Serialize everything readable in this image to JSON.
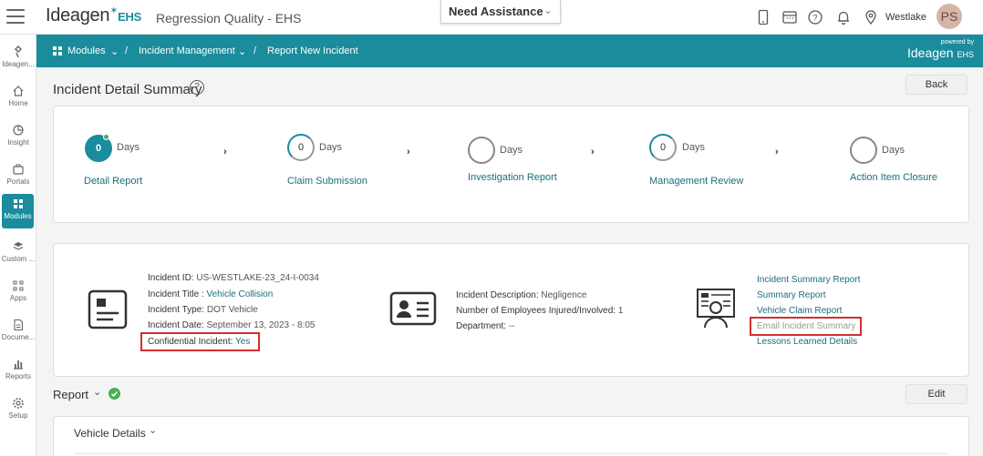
{
  "header": {
    "logo_text": "Ideagen",
    "logo_ehs": "EHS",
    "app_title": "Regression Quality - EHS",
    "assistance_label": "Need Assistance",
    "org_name": "Westlake",
    "avatar_initials": "PS"
  },
  "sidebar": {
    "items": [
      {
        "label": "Ideagen...",
        "icon": "ideagen-logo-icon"
      },
      {
        "label": "Home",
        "icon": "home-icon"
      },
      {
        "label": "Insight",
        "icon": "insight-icon"
      },
      {
        "label": "Portals",
        "icon": "portals-icon"
      },
      {
        "label": "Modules",
        "icon": "modules-icon",
        "active": true
      },
      {
        "label": "Custom ...",
        "icon": "custom-icon"
      },
      {
        "label": "Apps",
        "icon": "apps-icon"
      },
      {
        "label": "Docume...",
        "icon": "documents-icon"
      },
      {
        "label": "Reports",
        "icon": "reports-icon"
      },
      {
        "label": "Setup",
        "icon": "setup-icon"
      }
    ]
  },
  "breadcrumb": {
    "modules": "Modules",
    "sep1": "/",
    "incident_management": "Incident Management",
    "sep2": "/",
    "current": "Report New Incident",
    "powered_by": "powered by",
    "powered_logo": "Ideagen",
    "powered_ehs": "EHS"
  },
  "page": {
    "title": "Incident Detail Summary",
    "help_glyph": "?",
    "back_label": "Back"
  },
  "steps": [
    {
      "label": "Detail Report",
      "count": "0",
      "days": "Days",
      "state": "filled"
    },
    {
      "label": "Claim Submission",
      "count": "0",
      "days": "Days",
      "state": "partial"
    },
    {
      "label": "Investigation Report",
      "count": "",
      "days": "Days",
      "state": "empty"
    },
    {
      "label": "Management Review",
      "count": "0",
      "days": "Days",
      "state": "partial"
    },
    {
      "label": "Action Item Closure",
      "count": "",
      "days": "Days",
      "state": "empty"
    }
  ],
  "step_arrow": "›",
  "incident": {
    "id_label": "Incident ID:",
    "id_value": "US-WESTLAKE-23_24-I-0034",
    "title_label": "Incident Title :",
    "title_value": "Vehicle Collision",
    "type_label": "Incident Type:",
    "type_value": "DOT Vehicle",
    "date_label": "Incident Date:",
    "date_value": "September 13, 2023 - 8:05",
    "confidential_label": "Confidential Incident:",
    "confidential_value": "Yes",
    "description_label": "Incident Description:",
    "description_value": "Negligence",
    "injured_label": "Number of Employees Injured/Involved:",
    "injured_value": "1",
    "department_label": "Department:",
    "department_value": "--"
  },
  "reports": {
    "links": [
      "Incident Summary Report",
      "Summary Report",
      "Vehicle Claim Report",
      "Email Incident Summary",
      "Lessons Learned Details"
    ]
  },
  "report_section": {
    "title": "Report",
    "edit_label": "Edit",
    "vehicle_details": "Vehicle Details"
  },
  "colors": {
    "accent": "#1a8c9b",
    "highlight": "#d32f2f",
    "success": "#4caf50"
  }
}
